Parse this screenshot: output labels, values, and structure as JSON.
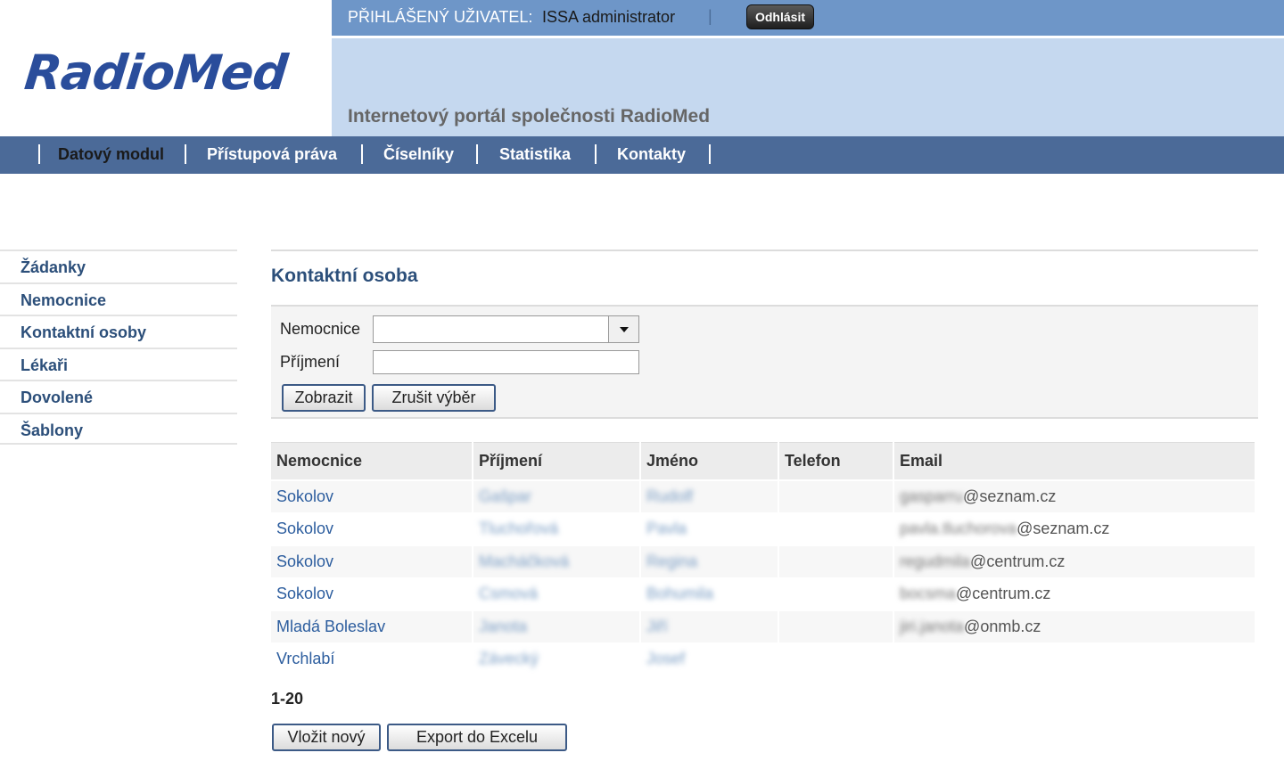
{
  "header": {
    "logo_text": "RadioMed",
    "user_label": "PŘIHLÁŠENÝ UŽIVATEL:",
    "user_name": "ISSA administrator",
    "separator": "|",
    "logout_label": "Odhlásit",
    "subtitle": "Internetový portál společnosti RadioMed"
  },
  "nav": {
    "items": [
      {
        "label": "Datový modul",
        "active": true
      },
      {
        "label": "Přístupová práva",
        "active": false
      },
      {
        "label": "Číselníky",
        "active": false
      },
      {
        "label": "Statistika",
        "active": false
      },
      {
        "label": "Kontakty",
        "active": false
      }
    ]
  },
  "sidebar": {
    "items": [
      {
        "label": "Žádanky"
      },
      {
        "label": "Nemocnice"
      },
      {
        "label": "Kontaktní osoby"
      },
      {
        "label": "Lékaři"
      },
      {
        "label": "Dovolené"
      },
      {
        "label": "Šablony"
      }
    ]
  },
  "main": {
    "title": "Kontaktní osoba",
    "filter": {
      "hospital_label": "Nemocnice",
      "hospital_value": "",
      "surname_label": "Příjmení",
      "surname_value": "",
      "show_button": "Zobrazit",
      "clear_button": "Zrušit výběr"
    },
    "table": {
      "columns": [
        "Nemocnice",
        "Příjmení",
        "Jméno",
        "Telefon",
        "Email"
      ],
      "rows": [
        {
          "hospital": "Sokolov",
          "surname": "Gašpar",
          "name": "Rudolf",
          "phone": "",
          "email_local": "gasparru",
          "email_domain": "@seznam.cz"
        },
        {
          "hospital": "Sokolov",
          "surname": "Tluchořová",
          "name": "Pavla",
          "phone": "",
          "email_local": "pavla.tluchorova",
          "email_domain": "@seznam.cz"
        },
        {
          "hospital": "Sokolov",
          "surname": "Macháčková",
          "name": "Regina",
          "phone": "",
          "email_local": "regudmila",
          "email_domain": "@centrum.cz"
        },
        {
          "hospital": "Sokolov",
          "surname": "Csmová",
          "name": "Bohumila",
          "phone": "",
          "email_local": "bocsma",
          "email_domain": "@centrum.cz"
        },
        {
          "hospital": "Mladá Boleslav",
          "surname": "Janota",
          "name": "Jiří",
          "phone": "",
          "email_local": "jiri.janota",
          "email_domain": "@onmb.cz"
        },
        {
          "hospital": "Vrchlabí",
          "surname": "Závecký",
          "name": "Josef",
          "phone": "",
          "email_local": "",
          "email_domain": ""
        }
      ]
    },
    "pager": "1-20",
    "insert_button": "Vložit nový",
    "export_button": "Export do Excelu"
  }
}
